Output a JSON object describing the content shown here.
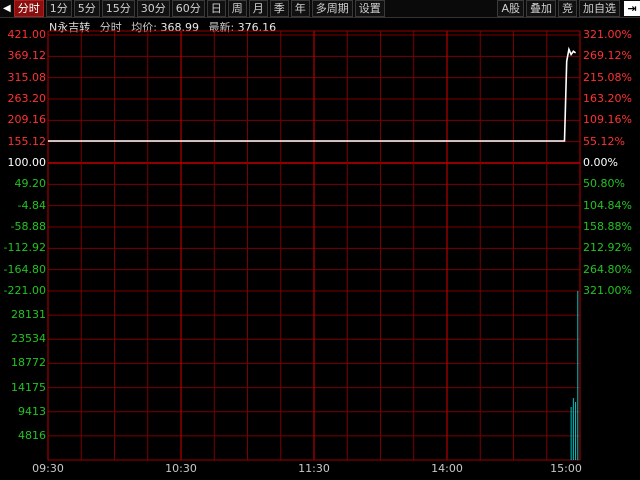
{
  "toolbar": {
    "buttons": [
      "分时",
      "1分",
      "5分",
      "15分",
      "30分",
      "60分",
      "日",
      "周",
      "月",
      "季",
      "年",
      "多周期",
      "设置"
    ],
    "active_index": 0,
    "right_buttons": [
      "A股",
      "叠加",
      "竞",
      "加自选"
    ],
    "left_arrow": "◀",
    "right_icon": "⇥"
  },
  "info": {
    "name": "N永吉转",
    "kind": "分时",
    "avg_label": "均价:",
    "avg_value": "368.99",
    "last_label": "最新:",
    "last_value": "376.16"
  },
  "colors": {
    "up": "#ff3232",
    "down": "#22c322",
    "neutral": "#ffffff",
    "grid": "#7a0000",
    "price_line": "#ffffff",
    "avg_line": "#ffd700",
    "volume": "#00c8c8"
  },
  "chart_data": {
    "type": "line",
    "price_axis": {
      "left_labels": [
        "421.00",
        "369.12",
        "315.08",
        "263.20",
        "209.16",
        "155.12",
        "100.00",
        "49.20",
        "-4.84",
        "-58.88",
        "-112.92",
        "-164.80",
        "-221.00"
      ],
      "right_labels": [
        "321.00%",
        "269.12%",
        "215.08%",
        "163.20%",
        "109.16%",
        "55.12%",
        "0.00%",
        "50.80%",
        "104.84%",
        "158.88%",
        "212.92%",
        "264.80%",
        "321.00%"
      ],
      "ylim": [
        -221.0,
        421.0
      ],
      "prev_close": 100.0
    },
    "volume_axis": {
      "labels": [
        "28131",
        "23534",
        "18772",
        "14175",
        "9413",
        "4816"
      ]
    },
    "x_labels": [
      "09:30",
      "10:30",
      "11:30",
      "14:00",
      "15:00"
    ],
    "series": [
      {
        "name": "",
        "points": [
          {
            "t": 0,
            "v": 155.12
          },
          {
            "t": 233,
            "v": 155.12
          },
          {
            "t": 234,
            "v": 355.0
          },
          {
            "t": 235,
            "v": 385.0
          },
          {
            "t": 236,
            "v": 372.0
          },
          {
            "t": 237,
            "v": 380.0
          },
          {
            "t": 238,
            "v": 376.16
          }
        ]
      }
    ],
    "volume": [
      {
        "t": 236,
        "v": 9413
      },
      {
        "t": 237,
        "v": 11000
      },
      {
        "t": 238,
        "v": 10300
      },
      {
        "t": 239,
        "v": 30000
      }
    ]
  }
}
